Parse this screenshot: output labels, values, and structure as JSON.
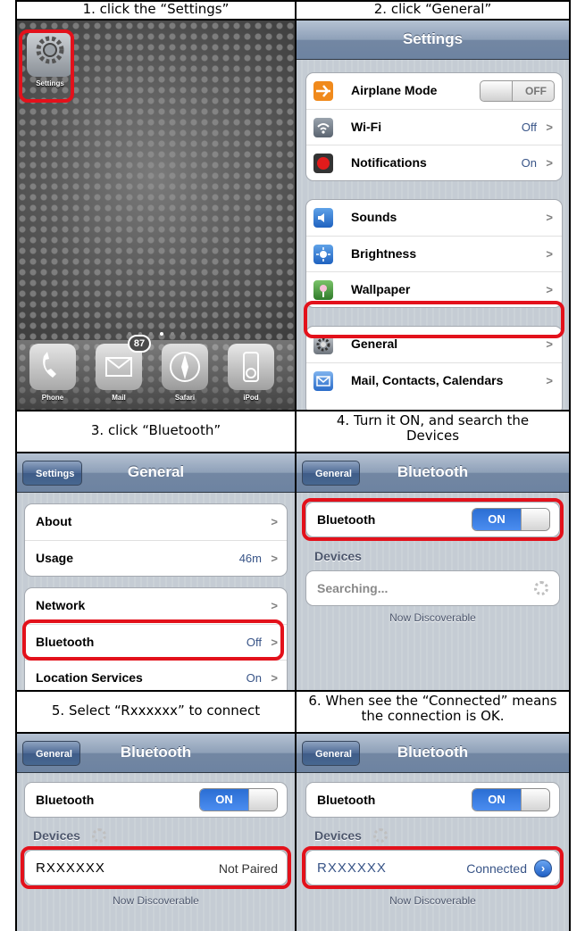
{
  "captions": {
    "step1": "1. click the “Settings”",
    "step2": "2. click “General”",
    "step3": "3.  click “Bluetooth”",
    "step4": "4.  Turn it ON, and search the Devices",
    "step5": "5. Select “Rxxxxxx” to connect",
    "step6": "6. When see the “Connected” means the connection is OK."
  },
  "home": {
    "settings_label": "Settings",
    "dock": [
      "Phone",
      "Mail",
      "Safari",
      "iPod"
    ],
    "mail_badge": "87"
  },
  "settings": {
    "title": "Settings",
    "airplane": "Airplane Mode",
    "airplane_state": "OFF",
    "wifi": "Wi-Fi",
    "wifi_value": "Off",
    "notifications": "Notifications",
    "notifications_value": "On",
    "sounds": "Sounds",
    "brightness": "Brightness",
    "wallpaper": "Wallpaper",
    "general": "General",
    "mail": "Mail, Contacts, Calendars"
  },
  "general": {
    "back": "Settings",
    "title": "General",
    "about": "About",
    "usage": "Usage",
    "usage_value": "46m",
    "network": "Network",
    "bluetooth": "Bluetooth",
    "bluetooth_value": "Off",
    "location": "Location Services",
    "location_value": "On"
  },
  "bt": {
    "back": "General",
    "title": "Bluetooth",
    "row_label": "Bluetooth",
    "on": "ON",
    "devices": "Devices",
    "searching": "Searching...",
    "discoverable": "Now Discoverable",
    "device_name": "RXXXXXX",
    "not_paired": "Not Paired",
    "connected": "Connected"
  },
  "colors": {
    "highlight": "#e3111b",
    "switch_on": "#3d80e6",
    "nav": "#7387a3"
  }
}
